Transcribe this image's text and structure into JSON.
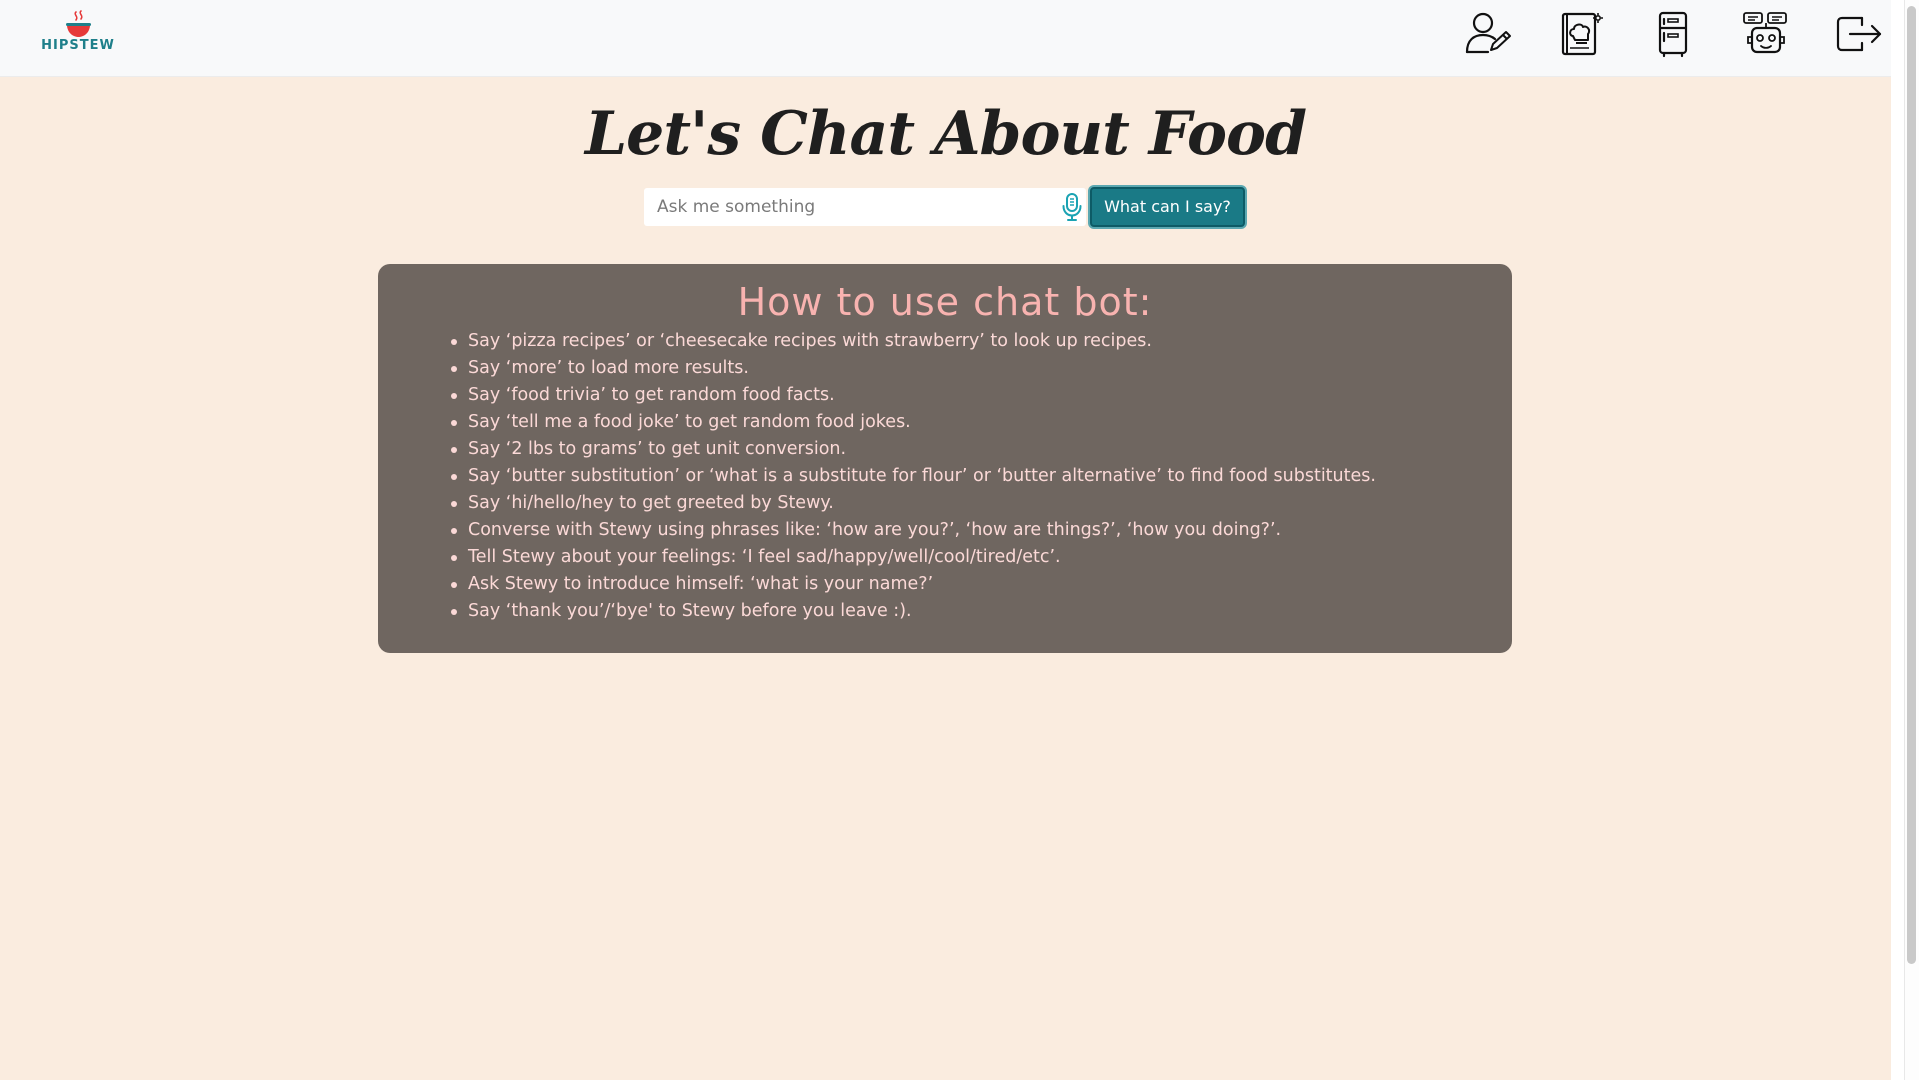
{
  "navbar": {
    "logo_text": "HIPSTEW",
    "icons": [
      {
        "name": "profile-edit-icon"
      },
      {
        "name": "recipe-book-icon"
      },
      {
        "name": "fridge-icon"
      },
      {
        "name": "chatbot-icon"
      },
      {
        "name": "logout-icon"
      }
    ]
  },
  "main": {
    "title": "Let's Chat About Food",
    "search": {
      "placeholder": "Ask me something",
      "value": ""
    },
    "help_button_label": "What can I say?"
  },
  "help": {
    "title": "How to use chat bot:",
    "items": [
      "Say ‘pizza recipes’ or ‘cheesecake recipes with strawberry’ to look up recipes.",
      "Say ‘more’ to load more results.",
      "Say ‘food trivia’ to get random food facts.",
      "Say ‘tell me a food joke’ to get random food jokes.",
      "Say ‘2 lbs to grams’ to get unit conversion.",
      "Say ‘butter substitution’ or ‘what is a substitute for flour’ or ‘butter alternative’ to find food substitutes.",
      "Say ‘hi/hello/hey to get greeted by Stewy.",
      "Converse with Stewy using phrases like: ‘how are you?’, ‘how are things?’, ‘how you doing?’.",
      "Tell Stewy about your feelings: ‘I feel sad/happy/well/cool/tired/etc’.",
      "Ask Stewy to introduce himself: ‘what is your name?’",
      "Say ‘thank you’/‘bye' to Stewy before you leave :)."
    ]
  },
  "colors": {
    "accent": "#1a7a86",
    "page_background": "#faecdf",
    "panel_background": "#6f6660",
    "panel_title": "#f8b3b0",
    "logo_bowl": "#e63939"
  }
}
